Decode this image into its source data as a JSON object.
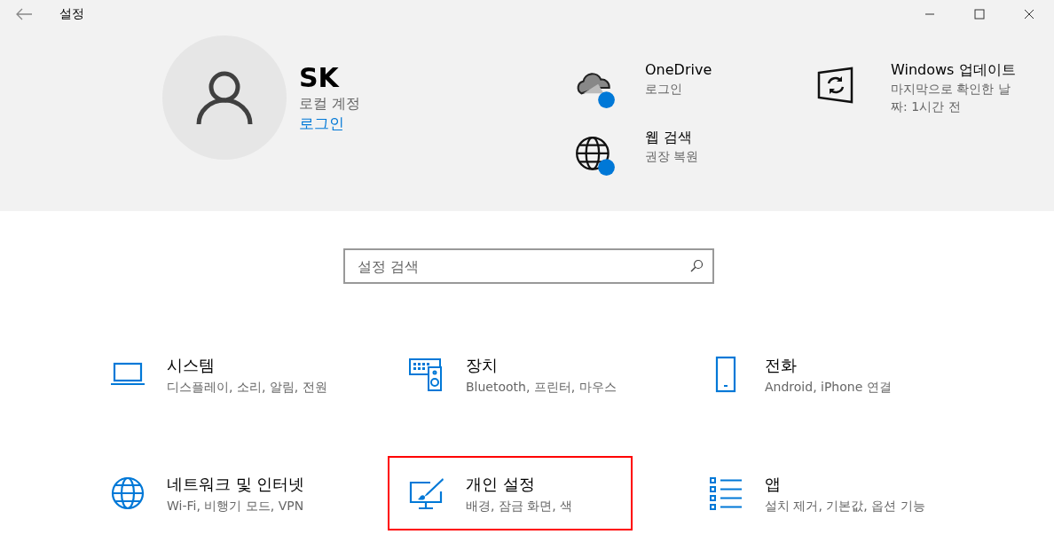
{
  "window": {
    "title": "설정"
  },
  "account": {
    "name": "SK",
    "type": "로컬 계정",
    "link": "로그인"
  },
  "services": [
    {
      "kind": "cloud",
      "title": "OneDrive",
      "subtitle": "로그인"
    },
    {
      "kind": "globe",
      "title": "웹 검색",
      "subtitle": "권장 복원"
    }
  ],
  "update": {
    "title": "Windows 업데이트",
    "subtitle": "마지막으로 확인한 날짜: 1시간 전"
  },
  "search": {
    "placeholder": "설정 검색"
  },
  "categories": [
    {
      "kind": "laptop",
      "title": "시스템",
      "description": "디스플레이, 소리, 알림, 전원",
      "highlighted": false
    },
    {
      "kind": "devices",
      "title": "장치",
      "description": "Bluetooth, 프린터, 마우스",
      "highlighted": false
    },
    {
      "kind": "phone",
      "title": "전화",
      "description": "Android, iPhone 연결",
      "highlighted": false
    },
    {
      "kind": "network",
      "title": "네트워크 및 인터넷",
      "description": "Wi-Fi, 비행기 모드, VPN",
      "highlighted": false
    },
    {
      "kind": "personalize",
      "title": "개인 설정",
      "description": "배경, 잠금 화면, 색",
      "highlighted": true
    },
    {
      "kind": "apps",
      "title": "앱",
      "description": "설치 제거, 기본값, 옵션 기능",
      "highlighted": false
    }
  ]
}
